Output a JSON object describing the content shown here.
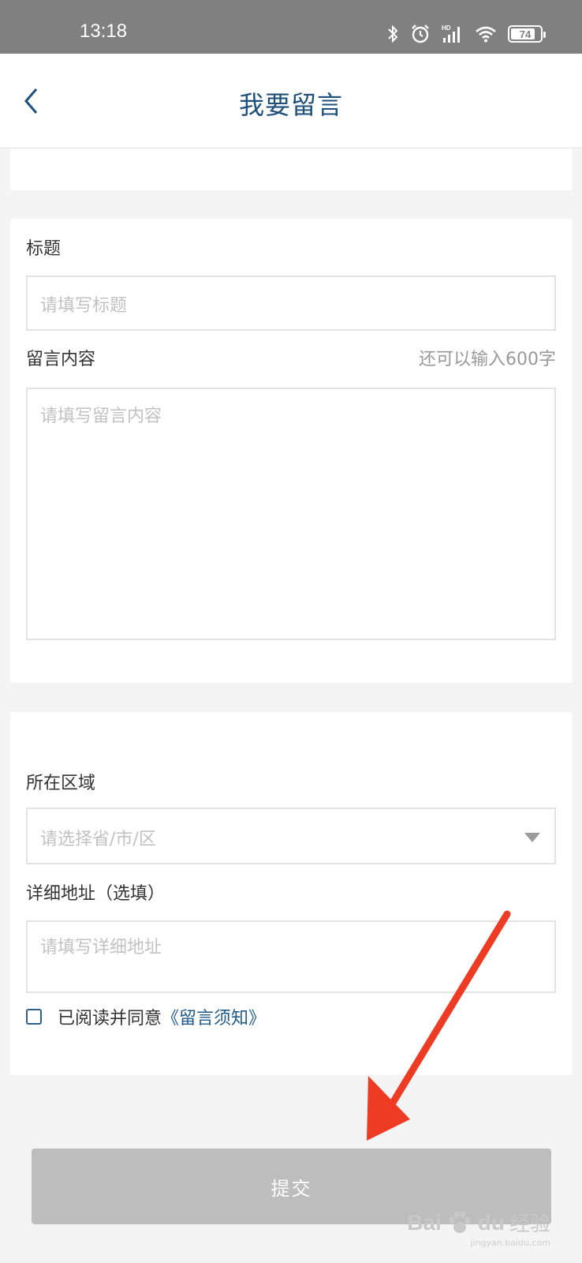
{
  "status_bar": {
    "time": "13:18",
    "battery": "74",
    "icons": [
      "bluetooth-icon",
      "alarm-icon",
      "hd-signal-icon",
      "wifi-icon",
      "battery-icon"
    ]
  },
  "header": {
    "title": "我要留言",
    "back_icon": "chevron-left-icon"
  },
  "form": {
    "title_label": "标题",
    "title_placeholder": "请填写标题",
    "content_label": "留言内容",
    "content_counter": "还可以输入600字",
    "content_placeholder": "请填写留言内容",
    "region_label": "所在区域",
    "region_placeholder": "请选择省/市/区",
    "address_label": "详细地址（选填）",
    "address_placeholder": "请填写详细地址",
    "agree_text": "已阅读并同意",
    "agree_link": "《留言须知》",
    "checkbox_checked": false
  },
  "submit_label": "提交",
  "colors": {
    "status_bar": "#808080",
    "title": "#1f4f7b",
    "link": "#1f5a8c",
    "button_disabled": "#bdbdbd",
    "annotation_arrow": "#ee3b24"
  },
  "watermark": {
    "brand": "Bai",
    "brand_suffix": "du",
    "cn": "经验",
    "url": "jingyan.baidu.com"
  }
}
